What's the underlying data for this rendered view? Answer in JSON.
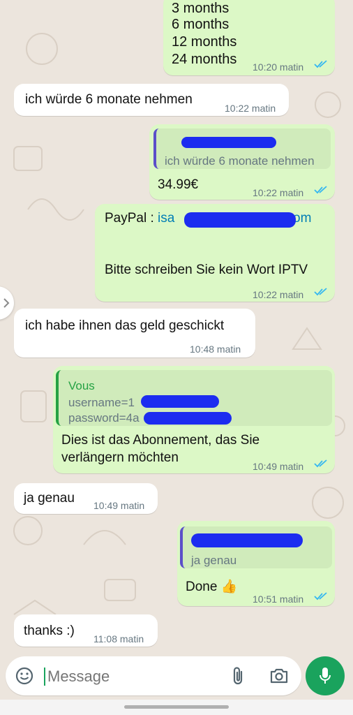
{
  "messages": {
    "m1": {
      "lines": [
        "3 months",
        "6 months",
        "12 months",
        "24 months"
      ],
      "time": "10:20 matin"
    },
    "m2": {
      "text": "ich würde 6 monate nehmen",
      "time": "10:22 matin"
    },
    "m3": {
      "quote_text": "ich würde 6 monate nehmen",
      "text": "34.99€",
      "time": "10:22 matin"
    },
    "m4": {
      "label": "PayPal : ",
      "email_start": "isa",
      "email_end": "om",
      "body": "Bitte schreiben Sie kein Wort IPTV",
      "time": "10:22 matin"
    },
    "m5": {
      "text": "ich habe ihnen das geld geschickt",
      "time": "10:48 matin"
    },
    "m6": {
      "quote_author": "Vous",
      "quote_line1": "username=1",
      "quote_line2": "password=4a",
      "line1": "Dies ist das Abonnement, das Sie",
      "line2": "verlängern möchten",
      "time": "10:49 matin"
    },
    "m7": {
      "text": "ja genau",
      "time": "10:49 matin"
    },
    "m8": {
      "quote_text": "ja genau",
      "text": "Done",
      "emoji": "👍",
      "time": "10:51 matin"
    },
    "m9": {
      "text": "thanks :)",
      "time": "11:08 matin"
    }
  },
  "composer": {
    "placeholder": "Message"
  },
  "icons": {
    "emoji": "emoji-icon",
    "attach": "paperclip-icon",
    "camera": "camera-icon",
    "mic": "microphone-icon",
    "ticks": "double-check-icon",
    "expand": "chevron-right-icon"
  },
  "colors": {
    "outgoing_bubble": "#dcf8c6",
    "incoming_bubble": "#ffffff",
    "chat_background": "#ece5dd",
    "read_ticks": "#34b7f1",
    "send_button": "#1aa35d",
    "redaction": "#1c2cf0",
    "link": "#027eb5"
  }
}
